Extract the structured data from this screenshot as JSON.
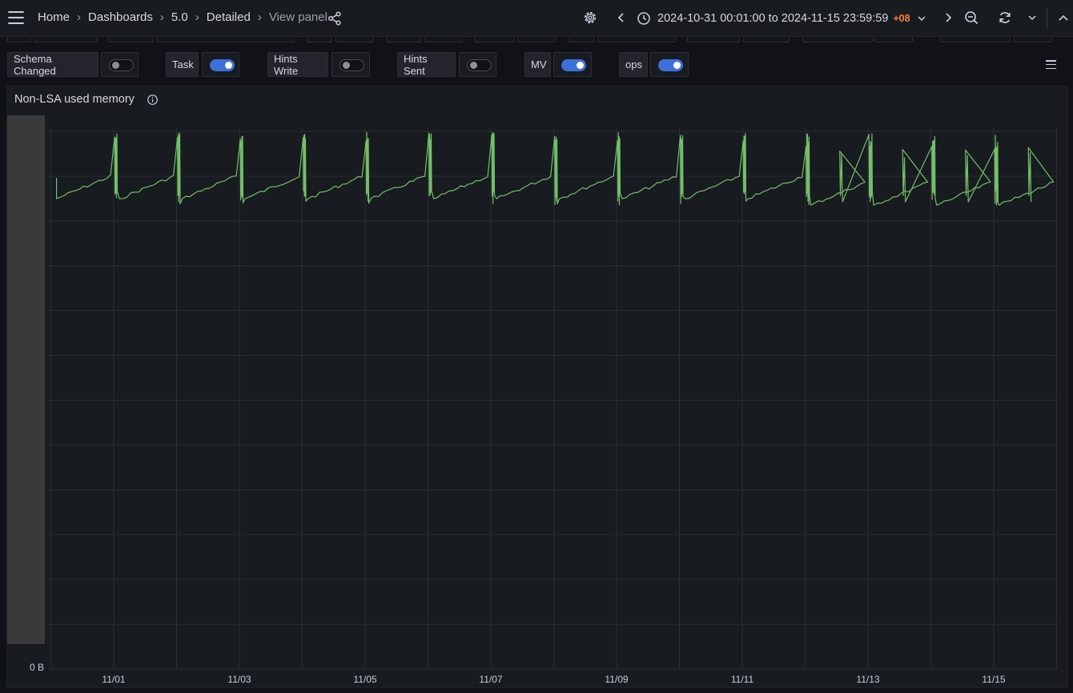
{
  "nav": {
    "breadcrumbs": [
      "Home",
      "Dashboards",
      "5.0",
      "Detailed",
      "View panel"
    ],
    "time_range": "2024-10-31 00:01:00 to 2024-11-15 23:59:59",
    "timezone": "+08",
    "icons": [
      "menu-icon",
      "share-icon",
      "gear-icon",
      "chevron-left-icon",
      "clock-icon",
      "chevron-down-icon",
      "chevron-right-icon",
      "zoom-out-icon",
      "refresh-icon",
      "chevron-down-icon",
      "chevron-up-icon"
    ]
  },
  "variables": [
    {
      "label": "Schema Changed",
      "on": false
    },
    {
      "label": "Task",
      "on": true
    },
    {
      "label": "Hints Write",
      "on": false
    },
    {
      "label": "Hints Sent",
      "on": false
    },
    {
      "label": "MV",
      "on": true
    },
    {
      "label": "ops",
      "on": true
    }
  ],
  "panel": {
    "title": "Non-LSA used memory",
    "info_icon": "info-icon"
  },
  "colors": {
    "series": "#73bf69",
    "toggle_on": "#3d71d9",
    "timezone": "#ff7f33",
    "background": "#111217",
    "panel": "#181b1f"
  },
  "chart_data": {
    "type": "line",
    "xlabel": "",
    "ylabel": "",
    "x_ticks": [
      "11/01",
      "11/03",
      "11/05",
      "11/07",
      "11/09",
      "11/11",
      "11/13",
      "11/15"
    ],
    "y_ticks": [
      "0 B"
    ],
    "xlim": [
      "2024-10-31 00:01",
      "2024-11-15 23:59"
    ],
    "grid": true,
    "legend": "none",
    "series": [
      {
        "pattern": "daily sawtooth: sharp spikes near 00:00 each day, drop to baseline, slow climb through the day",
        "spike_days": [
          "10-31",
          "11-01",
          "11-02",
          "11-03",
          "11-04",
          "11-05",
          "11-06",
          "11-07",
          "11-08",
          "11-09",
          "11-10",
          "11-11",
          "11-12",
          "11-13",
          "11-14",
          "11-15"
        ],
        "extra_spikes_from": "11-12"
      }
    ]
  }
}
